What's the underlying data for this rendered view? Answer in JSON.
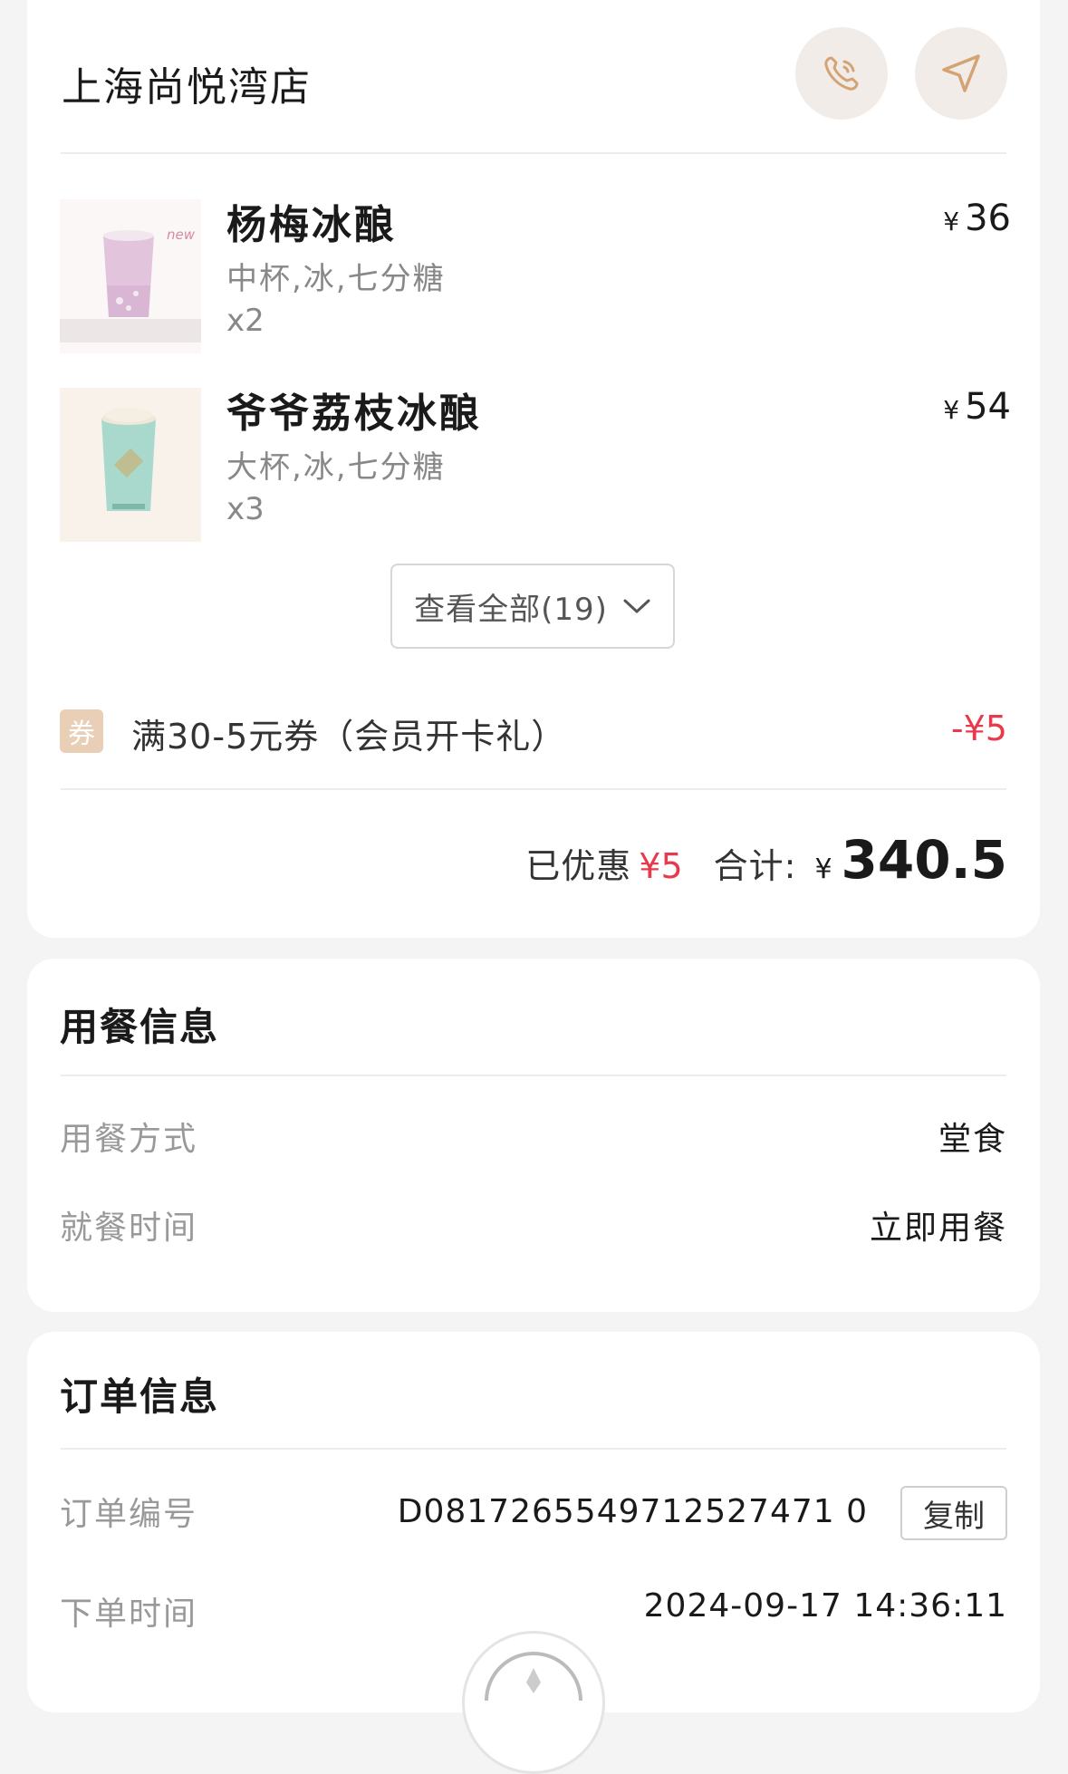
{
  "store": {
    "name": "上海尚悦湾店",
    "phone_icon": "phone-icon",
    "nav_icon": "navigation-arrow-icon"
  },
  "items": [
    {
      "name": "杨梅冰酿",
      "spec": "中杯,冰,七分糖",
      "qty": "x2",
      "price": "36",
      "currency": "¥",
      "thumb_badge": "new"
    },
    {
      "name": "爷爷荔枝冰酿",
      "spec": "大杯,冰,七分糖",
      "qty": "x3",
      "price": "54",
      "currency": "¥"
    }
  ],
  "view_all": {
    "label": "查看全部(19)"
  },
  "coupon": {
    "tag": "券",
    "text": "满30-5元券（会员开卡礼）",
    "amount": "-¥5"
  },
  "summary": {
    "saved_label": "已优惠",
    "saved_value": "¥5",
    "total_label": "合计:",
    "currency": "¥",
    "total": "340.5"
  },
  "dining": {
    "title": "用餐信息",
    "rows": [
      {
        "label": "用餐方式",
        "value": "堂食"
      },
      {
        "label": "就餐时间",
        "value": "立即用餐"
      }
    ]
  },
  "order": {
    "title": "订单信息",
    "number_label": "订单编号",
    "number": "D0817265549712527471 0",
    "copy_label": "复制",
    "time_label": "下单时间",
    "time": "2024-09-17 14:36:11"
  },
  "colors": {
    "accent_red": "#e83a4c",
    "coupon_tag": "#e8cfb5",
    "icon_tan": "#d4a373"
  }
}
